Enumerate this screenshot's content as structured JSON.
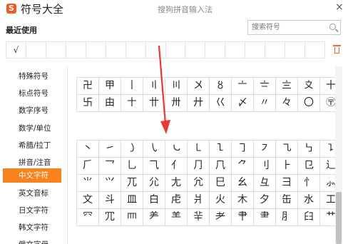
{
  "titlebar": {
    "logo": "S",
    "app_title": "符号大全",
    "subtitle": "搜狗拼音输入法",
    "close": "×"
  },
  "recent": {
    "label": "最近使用",
    "items": [
      "√",
      "",
      "",
      "",
      "",
      "",
      "",
      "",
      "",
      "",
      "",
      "",
      "",
      "",
      "",
      ""
    ]
  },
  "search": {
    "placeholder": "搜索符号"
  },
  "sidebar": {
    "items": [
      {
        "label": "特殊符号"
      },
      {
        "label": "标点符号"
      },
      {
        "label": "数字序号"
      },
      {
        "label": "数学/单位"
      },
      {
        "label": "希腊/拉丁"
      },
      {
        "label": "拼音/注音"
      },
      {
        "label": "中文字符",
        "active": true
      },
      {
        "label": "英文音标"
      },
      {
        "label": "日文字符"
      },
      {
        "label": "韩文字符"
      },
      {
        "label": "俄文字母"
      }
    ]
  },
  "grid_top": [
    [
      "卍",
      "甲",
      "丨",
      "〢",
      "〣",
      "〤",
      "〥",
      "〦",
      "〧",
      "〨",
      "〩",
      "十"
    ],
    [
      "卐",
      "由",
      "〸",
      "〹",
      "〺",
      "廾",
      "巜",
      "〆",
      "〃",
      "々",
      "〇",
      "〶"
    ]
  ],
  "grid_bottom": [
    [
      "丶",
      "㇀",
      "㇁",
      "㇂",
      "㇃",
      "㇄",
      "㇅",
      "㇆",
      "㇇",
      "㇈",
      "㇉",
      "㇊"
    ],
    [
      "⺁",
      "⺂",
      "⺃",
      "⺄",
      "⺅",
      "⺆",
      "⺇",
      "⺈",
      "⺉",
      "⺊",
      "⺋",
      "⻌"
    ],
    [
      "⺌",
      "⺍",
      "⺎",
      "⺏",
      "⺐",
      "⺑",
      "⺒",
      "⺓",
      "⺔",
      "⺕",
      "⺖",
      "⺗"
    ],
    [
      "⽂",
      "⽃",
      "⽫",
      "⽩",
      "⾌",
      "⽙",
      "⽕",
      "⽊",
      "⼣",
      "⽸",
      "⽔",
      "⼯"
    ],
    [
      "⺳",
      "⺴",
      "⺵",
      "⺶",
      "⺷",
      "⺸",
      "⺹",
      "⺺",
      "⺻",
      "⺼",
      "⺽",
      "⺾"
    ]
  ],
  "colors": {
    "accent": "#f7821e",
    "arrow": "#e53935",
    "logo": "#f15a24"
  }
}
